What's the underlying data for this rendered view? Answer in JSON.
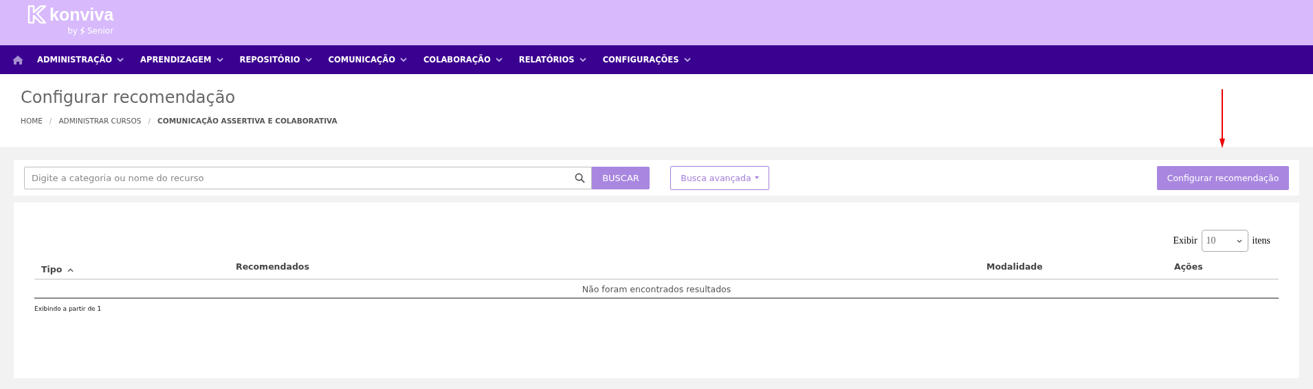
{
  "brand": {
    "name": "konviva",
    "tagline": "by",
    "partner": "Senior"
  },
  "nav": [
    {
      "label": "ADMINISTRAÇÃO"
    },
    {
      "label": "APRENDIZAGEM"
    },
    {
      "label": "REPOSITÓRIO"
    },
    {
      "label": "COMUNICAÇÃO"
    },
    {
      "label": "COLABORAÇÃO"
    },
    {
      "label": "RELATÓRIOS"
    },
    {
      "label": "CONFIGURAÇÕES"
    }
  ],
  "page_title": "Configurar recomendação",
  "breadcrumb": [
    {
      "label": "HOME",
      "current": false
    },
    {
      "separator": "/",
      "label": "ADMINISTRAR CURSOS",
      "current": false
    },
    {
      "separator": "/",
      "label": "COMUNICAÇÃO ASSERTIVA E COLABORATIVA",
      "current": true
    }
  ],
  "search": {
    "placeholder": "Digite a categoria ou nome do recurso",
    "button": "BUSCAR",
    "advanced": "Busca avançada"
  },
  "configure_button": "Configurar recomendação",
  "page_size": {
    "label": "Exibir",
    "value": "10",
    "suffix": "itens"
  },
  "table": {
    "columns": [
      {
        "label": "Tipo",
        "sorted": true
      },
      {
        "label": "Recomendados",
        "sorted": false
      },
      {
        "label": "Modalidade",
        "sorted": false
      },
      {
        "label": "Ações",
        "sorted": false
      }
    ],
    "empty_message": "Não foram encontrados resultados"
  },
  "footer_text": "Exibindo a partir de 1"
}
